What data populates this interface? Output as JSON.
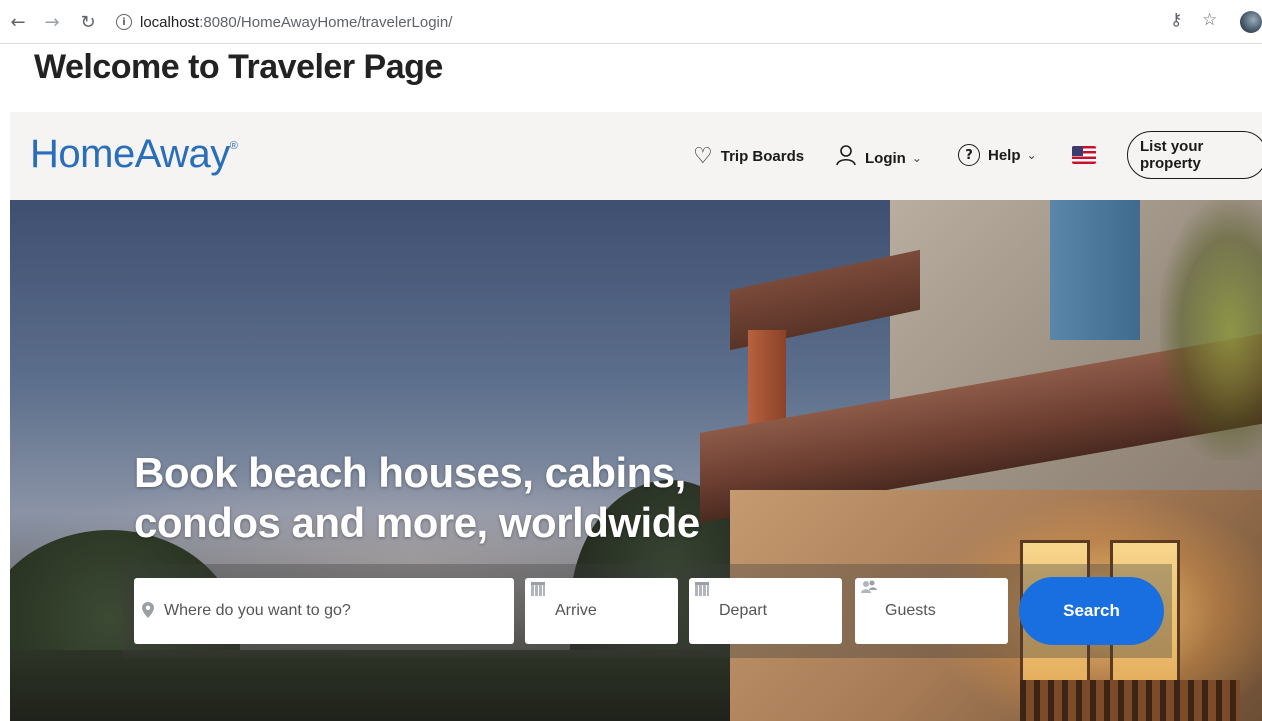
{
  "browser": {
    "url_host": "localhost",
    "url_path": ":8080/HomeAwayHome/travelerLogin/"
  },
  "page": {
    "heading": "Welcome to Traveler Page"
  },
  "header": {
    "logo": "HomeAway",
    "logo_mark": "®",
    "nav": {
      "trip_boards": "Trip Boards",
      "login": "Login",
      "help": "Help"
    },
    "list_property": "List your property"
  },
  "hero": {
    "headline_line1": "Book beach houses, cabins,",
    "headline_line2": "condos and more, worldwide"
  },
  "search": {
    "destination_placeholder": "Where do you want to go?",
    "arrive_label": "Arrive",
    "depart_label": "Depart",
    "guests_label": "Guests",
    "search_button": "Search"
  },
  "colors": {
    "brand_blue": "#2a6ebb",
    "search_button": "#1a6fe0",
    "header_bg": "#f5f4f2"
  },
  "icons": {
    "back": "arrow-left-icon",
    "forward": "arrow-right-icon",
    "reload": "reload-icon",
    "site_info": "info-icon",
    "key": "key-icon",
    "bookmark": "star-icon",
    "trip_boards": "heart-icon",
    "login": "user-icon",
    "help": "question-icon",
    "locale": "us-flag-icon",
    "destination": "map-pin-icon",
    "arrive": "calendar-icon",
    "depart": "calendar-icon",
    "guests": "guests-icon"
  }
}
